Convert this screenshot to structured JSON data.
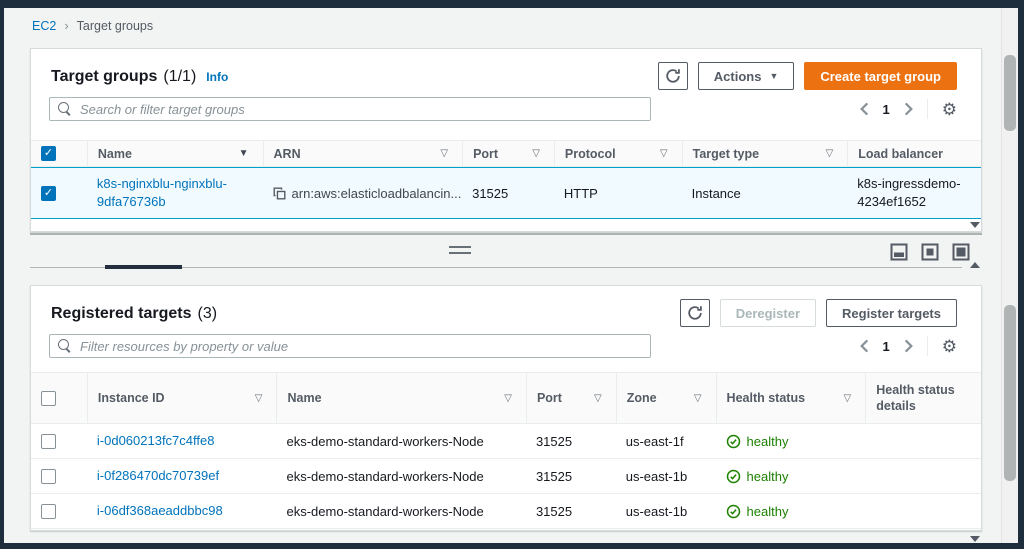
{
  "icons": {
    "sort_desc": "▼",
    "sort": "▽",
    "dropdown": "▼",
    "check": "✓",
    "gear": "⚙",
    "breadcrumb_sep": "›"
  },
  "colors": {
    "accent_orange": "#ec7211",
    "link_blue": "#0073bb",
    "healthy_green": "#1d8102",
    "selected_row_bg": "#f1faff",
    "selected_row_border": "#00a1c9"
  },
  "breadcrumb": {
    "items": [
      "EC2",
      "Target groups"
    ]
  },
  "top_panel": {
    "title": "Target groups",
    "count": "(1/1)",
    "info_label": "Info",
    "actions_label": "Actions",
    "create_label": "Create target group",
    "search_placeholder": "Search or filter target groups",
    "page": "1",
    "columns": [
      "Name",
      "ARN",
      "Port",
      "Protocol",
      "Target type",
      "Load balancer"
    ],
    "row": {
      "name": "k8s-nginxblu-nginxblu-9dfa76736b",
      "arn": "arn:aws:elasticloadbalancin...",
      "port": "31525",
      "protocol": "HTTP",
      "target_type": "Instance",
      "load_balancer": "k8s-ingressdemo-4234ef1652"
    }
  },
  "bottom_panel": {
    "title": "Registered targets",
    "count": "(3)",
    "deregister_label": "Deregister",
    "register_label": "Register targets",
    "filter_placeholder": "Filter resources by property or value",
    "page": "1",
    "columns": [
      "Instance ID",
      "Name",
      "Port",
      "Zone",
      "Health status",
      "Health status details"
    ],
    "rows": [
      {
        "instance_id": "i-0d060213fc7c4ffe8",
        "name": "eks-demo-standard-workers-Node",
        "port": "31525",
        "zone": "us-east-1f",
        "health": "healthy"
      },
      {
        "instance_id": "i-0f286470dc70739ef",
        "name": "eks-demo-standard-workers-Node",
        "port": "31525",
        "zone": "us-east-1b",
        "health": "healthy"
      },
      {
        "instance_id": "i-06df368aeaddbbc98",
        "name": "eks-demo-standard-workers-Node",
        "port": "31525",
        "zone": "us-east-1b",
        "health": "healthy"
      }
    ]
  }
}
